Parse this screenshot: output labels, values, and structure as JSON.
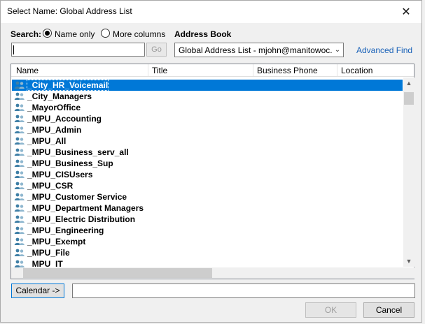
{
  "window": {
    "title": "Select Name: Global Address List"
  },
  "search": {
    "label": "Search:",
    "options": [
      "Name only",
      "More columns"
    ],
    "selected": "Name only",
    "value": "",
    "go_label": "Go"
  },
  "address_book": {
    "label": "Address Book",
    "selected": "Global Address List - mjohn@manitowoc.o",
    "advanced_find": "Advanced Find"
  },
  "list": {
    "columns": [
      "Name",
      "Title",
      "Business Phone",
      "Location"
    ],
    "rows": [
      "_City_HR_Voicemail",
      "_City_Managers",
      "_MayorOffice",
      "_MPU_Accounting",
      "_MPU_Admin",
      "_MPU_All",
      "_MPU_Business_serv_all",
      "_MPU_Business_Sup",
      "_MPU_CISUsers",
      "_MPU_CSR",
      "_MPU_Customer Service",
      "_MPU_Department Managers",
      "_MPU_Electric Distribution",
      "_MPU_Engineering",
      "_MPU_Exempt",
      "_MPU_File",
      "_MPU_IT"
    ],
    "selected_index": 0
  },
  "footer": {
    "calendar_button": "Calendar ->",
    "recipient_value": "",
    "ok_label": "OK",
    "cancel_label": "Cancel"
  },
  "colors": {
    "accent": "#0078d7",
    "link": "#1a62b8",
    "group_icon": "#3f7fa6"
  }
}
